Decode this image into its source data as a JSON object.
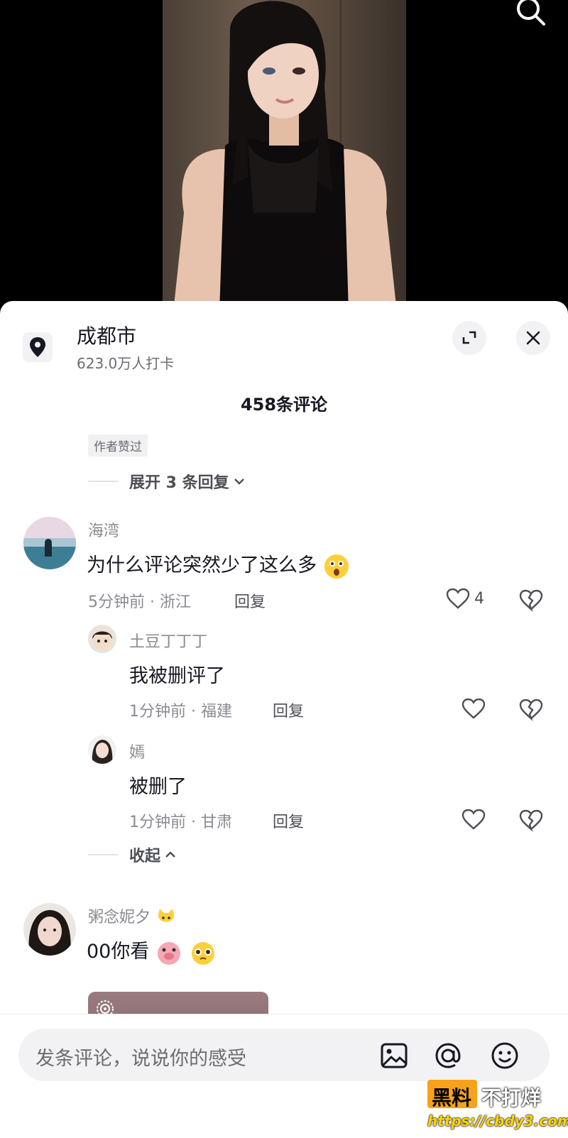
{
  "location": {
    "city": "成都市",
    "checkins": "623.0万人打卡"
  },
  "comments_header": {
    "count_label": "458条评论"
  },
  "prev_thread": {
    "tag": "作者赞过",
    "expand_label": "展开 3 条回复"
  },
  "comment_main": {
    "username": "海湾",
    "text": "为什么评论突然少了这么多",
    "meta": "5分钟前 · 浙江",
    "reply_label": "回复",
    "likes": "4",
    "replies": [
      {
        "username": "土豆丁丁丁",
        "text": "我被删评了",
        "meta": "1分钟前 · 福建",
        "reply_label": "回复"
      },
      {
        "username": "嫣",
        "text": "被删了",
        "meta": "1分钟前 · 甘肃",
        "reply_label": "回复"
      }
    ],
    "collapse_label": "收起"
  },
  "comment_second": {
    "username": "粥念妮夕",
    "text": "00你看"
  },
  "input": {
    "placeholder": "发条评论，说说你的感受"
  },
  "watermark": {
    "brand_a": "黑料",
    "brand_b": "不打烊",
    "url": "https://cbdy3.com"
  },
  "colors": {
    "sheet_bg": "#ffffff",
    "text_primary": "#161823",
    "text_secondary": "#8a8b91",
    "chip_bg": "#f2f2f4",
    "watermark_orange": "#f6a21a"
  },
  "icons": [
    "search-icon",
    "location-pin-icon",
    "expand-icon",
    "close-icon",
    "heart-icon",
    "broken-heart-icon",
    "image-icon",
    "at-icon",
    "emoji-icon"
  ]
}
